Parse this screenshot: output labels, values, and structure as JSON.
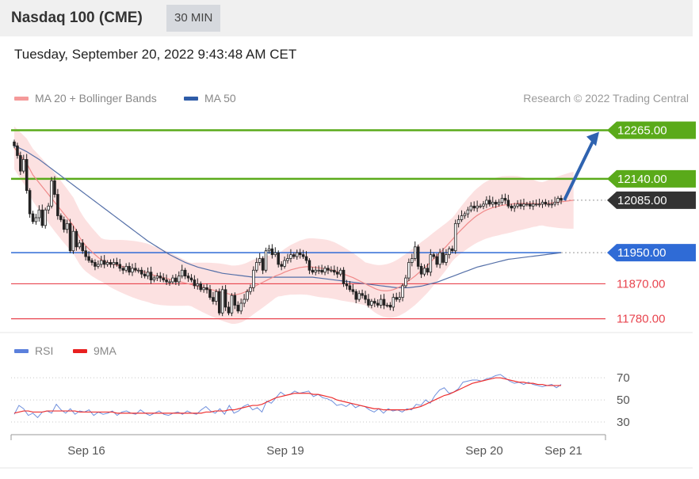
{
  "header": {
    "title": "Nasdaq 100 (CME)",
    "timeframe": "30 MIN",
    "datetime": "Tuesday, September 20, 2022 9:43:48 AM CET"
  },
  "legend": {
    "ma20_label": "MA 20 + Bollinger Bands",
    "ma50_label": "MA 50",
    "credit": "Research © 2022 Trading Central"
  },
  "rsi_legend": {
    "rsi_label": "RSI",
    "ma_label": "9MA"
  },
  "colors": {
    "resistance": "#5aaa1a",
    "pivot": "#2f6bd6",
    "support": "#e8454f",
    "last_price_tag": "#333333",
    "bollinger_fill": "#fcdcdc",
    "ma20": "#f08a8a",
    "ma50": "#5570a8",
    "rsi": "#6f8fdc",
    "rsi_ma": "#ee3030",
    "candle": "#222222",
    "up_candle": "#ffffff"
  },
  "chart_data": [
    {
      "type": "candlestick",
      "title": "Nasdaq 100 (CME)",
      "timeframe": "30 MIN",
      "ylim": [
        11765,
        12315
      ],
      "x_tick_labels": [
        "Sep 16",
        "Sep 19",
        "Sep 20",
        "Sep 21"
      ],
      "close_series": [
        12225,
        12200,
        12160,
        12190,
        12110,
        12050,
        12030,
        12040,
        12060,
        12020,
        12060,
        12070,
        12135,
        12100,
        12045,
        12035,
        12010,
        12025,
        11955,
        12005,
        11965,
        11975,
        11955,
        11940,
        11930,
        11925,
        11915,
        11920,
        11930,
        11920,
        11925,
        11920,
        11925,
        11920,
        11910,
        11905,
        11915,
        11900,
        11910,
        11905,
        11905,
        11895,
        11890,
        11900,
        11880,
        11885,
        11890,
        11885,
        11880,
        11875,
        11875,
        11885,
        11875,
        11890,
        11905,
        11890,
        11885,
        11880,
        11865,
        11870,
        11855,
        11860,
        11855,
        11835,
        11825,
        11850,
        11795,
        11855,
        11810,
        11795,
        11840,
        11815,
        11800,
        11820,
        11830,
        11850,
        11860,
        11905,
        11925,
        11935,
        11905,
        11955,
        11960,
        11945,
        11950,
        11920,
        11915,
        11930,
        11935,
        11945,
        11940,
        11950,
        11945,
        11940,
        11930,
        11905,
        11900,
        11905,
        11905,
        11900,
        11910,
        11905,
        11905,
        11900,
        11895,
        11905,
        11870,
        11865,
        11855,
        11850,
        11830,
        11845,
        11840,
        11830,
        11815,
        11825,
        11820,
        11815,
        11830,
        11815,
        11815,
        11810,
        11835,
        11830,
        11835,
        11865,
        11885,
        11925,
        11935,
        11965,
        11915,
        11895,
        11910,
        11900,
        11945,
        11940,
        11920,
        11950,
        11925,
        11945,
        11960,
        11955,
        12025,
        12035,
        12045,
        12050,
        12060,
        12070,
        12065,
        12070,
        12070,
        12075,
        12085,
        12075,
        12080,
        12075,
        12080,
        12090,
        12085,
        12070,
        12065,
        12070,
        12075,
        12070,
        12075,
        12075,
        12070,
        12075,
        12075,
        12075,
        12080,
        12075,
        12075,
        12075,
        12080,
        12090,
        12085
      ],
      "moving_averages": {
        "ma20": [
          12220,
          12210,
          12200,
          12190,
          12180,
          12165,
          12150,
          12140,
          12130,
          12120,
          12110,
          12100,
          12090,
          12080,
          12070,
          12060,
          12050,
          12040,
          12030,
          12020,
          12005,
          11990,
          11978,
          11968,
          11960,
          11952,
          11945,
          11938,
          11932,
          11928,
          11925,
          11922,
          11920,
          11918,
          11916,
          11914,
          11912,
          11910,
          11908,
          11906,
          11904,
          11902,
          11900,
          11898,
          11895,
          11892,
          11890,
          11888,
          11886,
          11884,
          11882,
          11880,
          11878,
          11876,
          11874,
          11872,
          11870,
          11868,
          11866,
          11864,
          11862,
          11860,
          11858,
          11856,
          11854,
          11852,
          11850,
          11848,
          11846,
          11844,
          11842,
          11842,
          11843,
          11845,
          11848,
          11852,
          11857,
          11862,
          11866,
          11870,
          11874,
          11878,
          11882,
          11886,
          11890,
          11893,
          11896,
          11900,
          11903,
          11906,
          11908,
          11910,
          11912,
          11913,
          11914,
          11914,
          11913,
          11912,
          11911,
          11910,
          11909,
          11908,
          11906,
          11904,
          11901,
          11898,
          11895,
          11892,
          11889,
          11886,
          11882,
          11878,
          11874,
          11870,
          11866,
          11862,
          11858,
          11855,
          11853,
          11852,
          11852,
          11853,
          11855,
          11858,
          11862,
          11867,
          11872,
          11878,
          11884,
          11890,
          11897,
          11904,
          11911,
          11918,
          11926,
          11934,
          11942,
          11950,
          11958,
          11966,
          11975,
          11984,
          11993,
          12002,
          12010,
          12018,
          12026,
          12033,
          12040,
          12046,
          12051,
          12056,
          12060,
          12063,
          12066,
          12068,
          12070,
          12072,
          12073,
          12074,
          12075,
          12076,
          12077,
          12077,
          12077,
          12077,
          12077,
          12077,
          12076,
          12076,
          12076,
          12076,
          12077,
          12078,
          12079,
          12080,
          12081,
          12082,
          12083,
          12084,
          12085
        ],
        "ma50": [
          12225,
          12222,
          12218,
          12214,
          12210,
          12205,
          12200,
          12195,
          12190,
          12184,
          12178,
          12172,
          12166,
          12160,
          12154,
          12148,
          12142,
          12136,
          12130,
          12124,
          12118,
          12112,
          12106,
          12100,
          12094,
          12088,
          12082,
          12076,
          12070,
          12064,
          12058,
          12052,
          12046,
          12040,
          12034,
          12028,
          12022,
          12016,
          12010,
          12004,
          11998,
          11992,
          11986,
          11980,
          11975,
          11970,
          11965,
          11960,
          11955,
          11950,
          11945,
          11941,
          11937,
          11933,
          11929,
          11925,
          11922,
          11919,
          11916,
          11913,
          11911,
          11909,
          11907,
          11905,
          11903,
          11901,
          11899,
          11897,
          11896,
          11895,
          11894,
          11893,
          11892,
          11891,
          11890,
          11889,
          11888,
          11887,
          11887,
          11887,
          11887,
          11887,
          11887,
          11887,
          11887,
          11887,
          11887,
          11887,
          11887,
          11887,
          11887,
          11887,
          11887,
          11887,
          11887,
          11887,
          11887,
          11886,
          11885,
          11884,
          11883,
          11882,
          11881,
          11880,
          11879,
          11878,
          11877,
          11876,
          11875,
          11874,
          11873,
          11872,
          11871,
          11870,
          11869,
          11868,
          11867,
          11866,
          11865,
          11864,
          11863,
          11862,
          11861,
          11860,
          11860,
          11860,
          11860,
          11860,
          11861,
          11862,
          11863,
          11864,
          11866,
          11868,
          11870,
          11872,
          11874,
          11877,
          11880,
          11883,
          11886,
          11889,
          11892,
          11895,
          11898,
          11901,
          11904,
          11907,
          11910,
          11913,
          11915,
          11917,
          11919,
          11921,
          11923,
          11925,
          11927,
          11929,
          11931,
          11933,
          11934,
          11935,
          11936,
          11937,
          11938,
          11939,
          11940,
          11941,
          11942,
          11943,
          11944,
          11945,
          11946,
          11947,
          11948,
          11949,
          11950
        ]
      },
      "levels": [
        {
          "label": "12265.00",
          "value": 12265,
          "kind": "resistance"
        },
        {
          "label": "12140.00",
          "value": 12140,
          "kind": "resistance"
        },
        {
          "label": "12085.00",
          "value": 12085,
          "kind": "last"
        },
        {
          "label": "11950.00",
          "value": 11950,
          "kind": "pivot"
        },
        {
          "label": "11870.00",
          "value": 11870,
          "kind": "support"
        },
        {
          "label": "11780.00",
          "value": 11780,
          "kind": "support"
        }
      ],
      "target_arrow": {
        "from": 12085,
        "to": 12265
      }
    },
    {
      "type": "line",
      "title": "RSI",
      "ylim": [
        25,
        78
      ],
      "y_ticks": [
        {
          "label": "70",
          "value": 70
        },
        {
          "label": "50",
          "value": 50
        },
        {
          "label": "30",
          "value": 30
        }
      ],
      "series": [
        {
          "name": "RSI",
          "values": [
            37,
            45,
            42,
            36,
            38,
            34,
            39,
            40,
            38,
            46,
            41,
            38,
            42,
            37,
            40,
            39,
            41,
            36,
            39,
            37,
            38,
            40,
            36,
            39,
            40,
            38,
            37,
            41,
            38,
            36,
            38,
            40,
            37,
            36,
            38,
            39,
            37,
            40,
            38,
            37,
            41,
            44,
            40,
            38,
            42,
            37,
            45,
            38,
            40,
            44,
            46,
            41,
            43,
            39,
            49,
            47,
            52,
            57,
            54,
            55,
            58,
            56,
            57,
            58,
            53,
            55,
            52,
            51,
            49,
            45,
            46,
            44,
            47,
            43,
            45,
            44,
            41,
            39,
            42,
            38,
            42,
            40,
            41,
            39,
            42,
            41,
            46,
            45,
            50,
            47,
            54,
            59,
            61,
            56,
            57,
            60,
            66,
            67,
            68,
            68,
            67,
            69,
            70,
            72,
            73,
            70,
            67,
            65,
            66,
            64,
            66,
            64,
            63,
            62,
            63,
            64,
            61,
            64
          ]
        },
        {
          "name": "9MA",
          "values": [
            38,
            39,
            40,
            40,
            39,
            39,
            39,
            40,
            40,
            40,
            40,
            40,
            40,
            40,
            39,
            39,
            39,
            39,
            39,
            39,
            39,
            39,
            38,
            38,
            38,
            38,
            38,
            38,
            38,
            38,
            38,
            38,
            38,
            38,
            38,
            38,
            38,
            38,
            38,
            38,
            38,
            39,
            39,
            40,
            40,
            40,
            41,
            41,
            42,
            43,
            44,
            45,
            45,
            46,
            48,
            50,
            52,
            53,
            54,
            55,
            56,
            56,
            56,
            56,
            55,
            55,
            54,
            53,
            52,
            50,
            49,
            48,
            47,
            46,
            45,
            44,
            43,
            42,
            42,
            41,
            41,
            41,
            41,
            41,
            41,
            42,
            43,
            44,
            46,
            48,
            50,
            52,
            54,
            55,
            57,
            59,
            61,
            63,
            65,
            66,
            67,
            68,
            69,
            70,
            70,
            69,
            68,
            67,
            66,
            66,
            65,
            65,
            64,
            64,
            63,
            63,
            63,
            63
          ]
        }
      ]
    }
  ]
}
